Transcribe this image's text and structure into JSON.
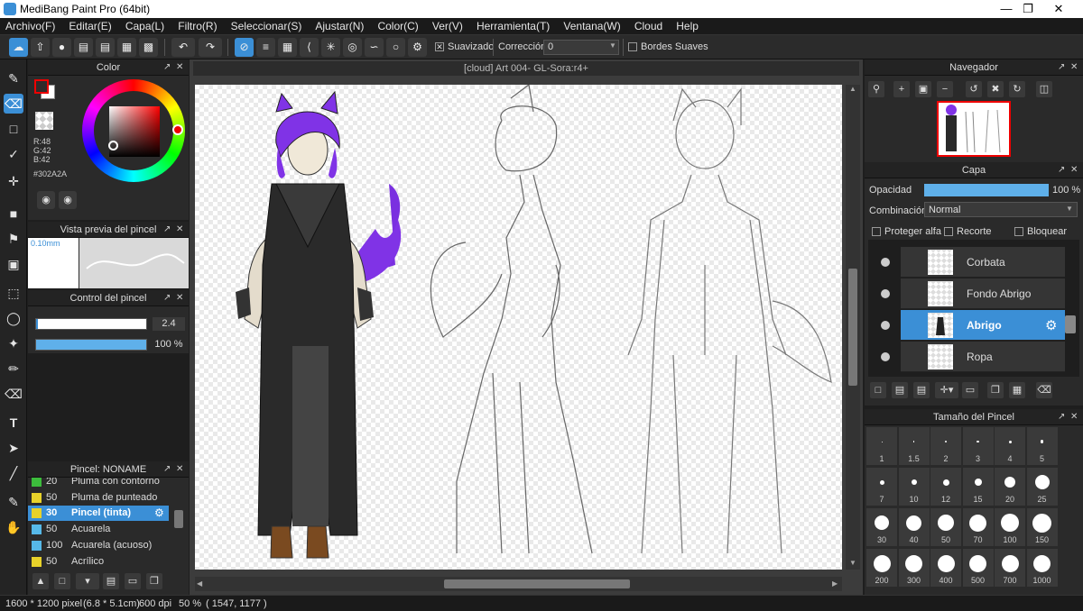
{
  "window": {
    "title": "MediBang Paint Pro (64bit)"
  },
  "menu": [
    "Archivo(F)",
    "Editar(E)",
    "Capa(L)",
    "Filtro(R)",
    "Seleccionar(S)",
    "Ajustar(N)",
    "Color(C)",
    "Ver(V)",
    "Herramienta(T)",
    "Ventana(W)",
    "Cloud",
    "Help"
  ],
  "toolbar": {
    "smooth_label": "Suavizado",
    "correction_label": "Corrección",
    "correction_value": "0",
    "soft_edges_label": "Bordes Suaves"
  },
  "color_panel": {
    "title": "Color",
    "r": "R:48",
    "g": "G:42",
    "b": "B:42",
    "hex": "#302A2A",
    "primary": "#302a2a",
    "secondary": "#ffffff"
  },
  "brush_preview": {
    "title": "Vista previa del pincel",
    "size": "0.10mm"
  },
  "brush_control": {
    "title": "Control del pincel",
    "size_value": "2.4",
    "opacity_value": "100 %",
    "size_fraction": 0.02,
    "opacity_fraction": 1.0
  },
  "brush_list": {
    "title": "Pincel: NONAME",
    "items": [
      {
        "num": "20",
        "name": "Pluma con contorno",
        "color": "#3cbc3c"
      },
      {
        "num": "50",
        "name": "Pluma de punteado",
        "color": "#e8d22a"
      },
      {
        "num": "30",
        "name": "Pincel (tinta)",
        "color": "#e8d22a",
        "selected": true
      },
      {
        "num": "50",
        "name": "Acuarela",
        "color": "#56b8e8"
      },
      {
        "num": "100",
        "name": "Acuarela (acuoso)",
        "color": "#56b8e8"
      },
      {
        "num": "50",
        "name": "Acrílico",
        "color": "#e8d22a"
      }
    ]
  },
  "document": {
    "tab": "[cloud] Art 004- GL-Sora:r4+"
  },
  "navigator": {
    "title": "Navegador"
  },
  "layers": {
    "title": "Capa",
    "opacity_label": "Opacidad",
    "opacity_value": "100 %",
    "opacity_fraction": 1.0,
    "blend_label": "Combinación",
    "blend_value": "Normal",
    "protect_alpha": "Proteger alfa",
    "clipping": "Recorte",
    "lock": "Bloquear",
    "items": [
      {
        "name": "Corbata"
      },
      {
        "name": "Fondo Abrigo"
      },
      {
        "name": "Abrigo",
        "selected": true
      },
      {
        "name": "Ropa"
      }
    ]
  },
  "brush_size": {
    "title": "Tamaño del Pincel",
    "sizes": [
      "1",
      "1.5",
      "2",
      "3",
      "4",
      "5",
      "7",
      "10",
      "12",
      "15",
      "20",
      "25",
      "30",
      "40",
      "50",
      "70",
      "100",
      "150",
      "200",
      "300",
      "400",
      "500",
      "700",
      "1000"
    ]
  },
  "status": {
    "dimensions": "1600 * 1200 pixel",
    "physical": "(6.8 * 5.1cm)",
    "dpi": "600 dpi",
    "zoom": "50 %",
    "coords": "( 1547, 1177 )"
  }
}
